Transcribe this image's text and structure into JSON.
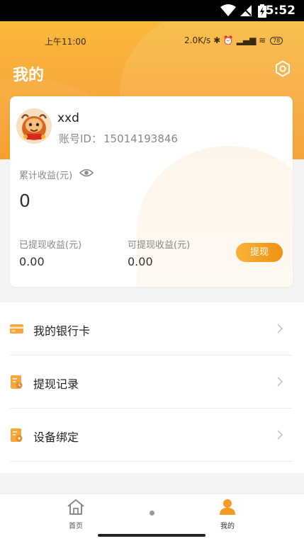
{
  "system_status": {
    "time": "5:52"
  },
  "inner_status": {
    "time": "上午11:00",
    "right": "2.0K/s ✱ ⏰ ▂▄▆ ≋",
    "battery": "78"
  },
  "page": {
    "title": "我的"
  },
  "profile": {
    "username": "xxd",
    "account_label": "账号ID：",
    "account_id": "15014193846"
  },
  "earnings": {
    "total_label": "累计收益(元)",
    "total_value": "0",
    "withdrawn_label": "已提现收益(元)",
    "withdrawn_value": "0.00",
    "available_label": "可提现收益(元)",
    "available_value": "0.00",
    "withdraw_button": "提现"
  },
  "menu": [
    {
      "label": "我的银行卡",
      "icon": "bank-card-icon"
    },
    {
      "label": "提现记录",
      "icon": "withdraw-record-icon"
    },
    {
      "label": "设备绑定",
      "icon": "device-bind-icon"
    }
  ],
  "tabs": [
    {
      "label": "首页",
      "icon": "home-icon",
      "active": false
    },
    {
      "label": "我的",
      "icon": "user-icon",
      "active": true
    }
  ],
  "colors": {
    "accent": "#f39a22",
    "accent_light": "#f9b93a",
    "inactive_tab": "#8a8a8a"
  }
}
